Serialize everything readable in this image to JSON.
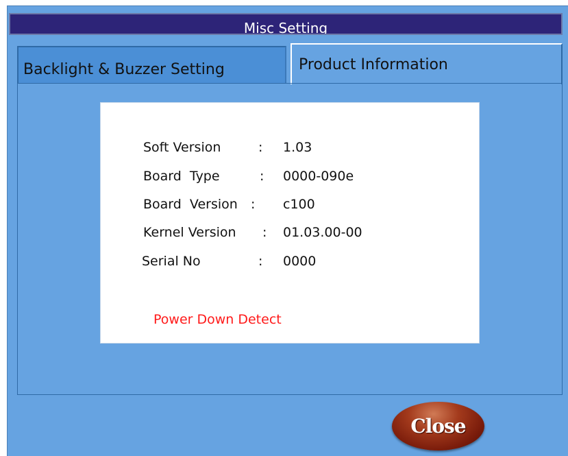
{
  "window": {
    "title": "Misc Setting"
  },
  "tabs": [
    {
      "label": "Backlight & Buzzer Setting",
      "active": false
    },
    {
      "label": "Product Information",
      "active": true
    }
  ],
  "product_info": {
    "rows": [
      {
        "label": "Soft Version",
        "colon": ":",
        "value": "1.03"
      },
      {
        "label": "Board  Type",
        "colon": ":",
        "value": "0000-090e"
      },
      {
        "label": "Board  Version",
        "colon": ":",
        "value": "c100"
      },
      {
        "label": "Kernel Version",
        "colon": ":",
        "value": "01.03.00-00"
      },
      {
        "label": "Serial No",
        "colon": ":",
        "value": "0000"
      }
    ],
    "status_text": "Power Down Detect",
    "status_color": "#ff1a1a"
  },
  "buttons": {
    "close_label": "Close"
  },
  "colors": {
    "window_bg": "#66a3e1",
    "titlebar_bg": "#2d2478",
    "close_button": "#8a2a12"
  }
}
